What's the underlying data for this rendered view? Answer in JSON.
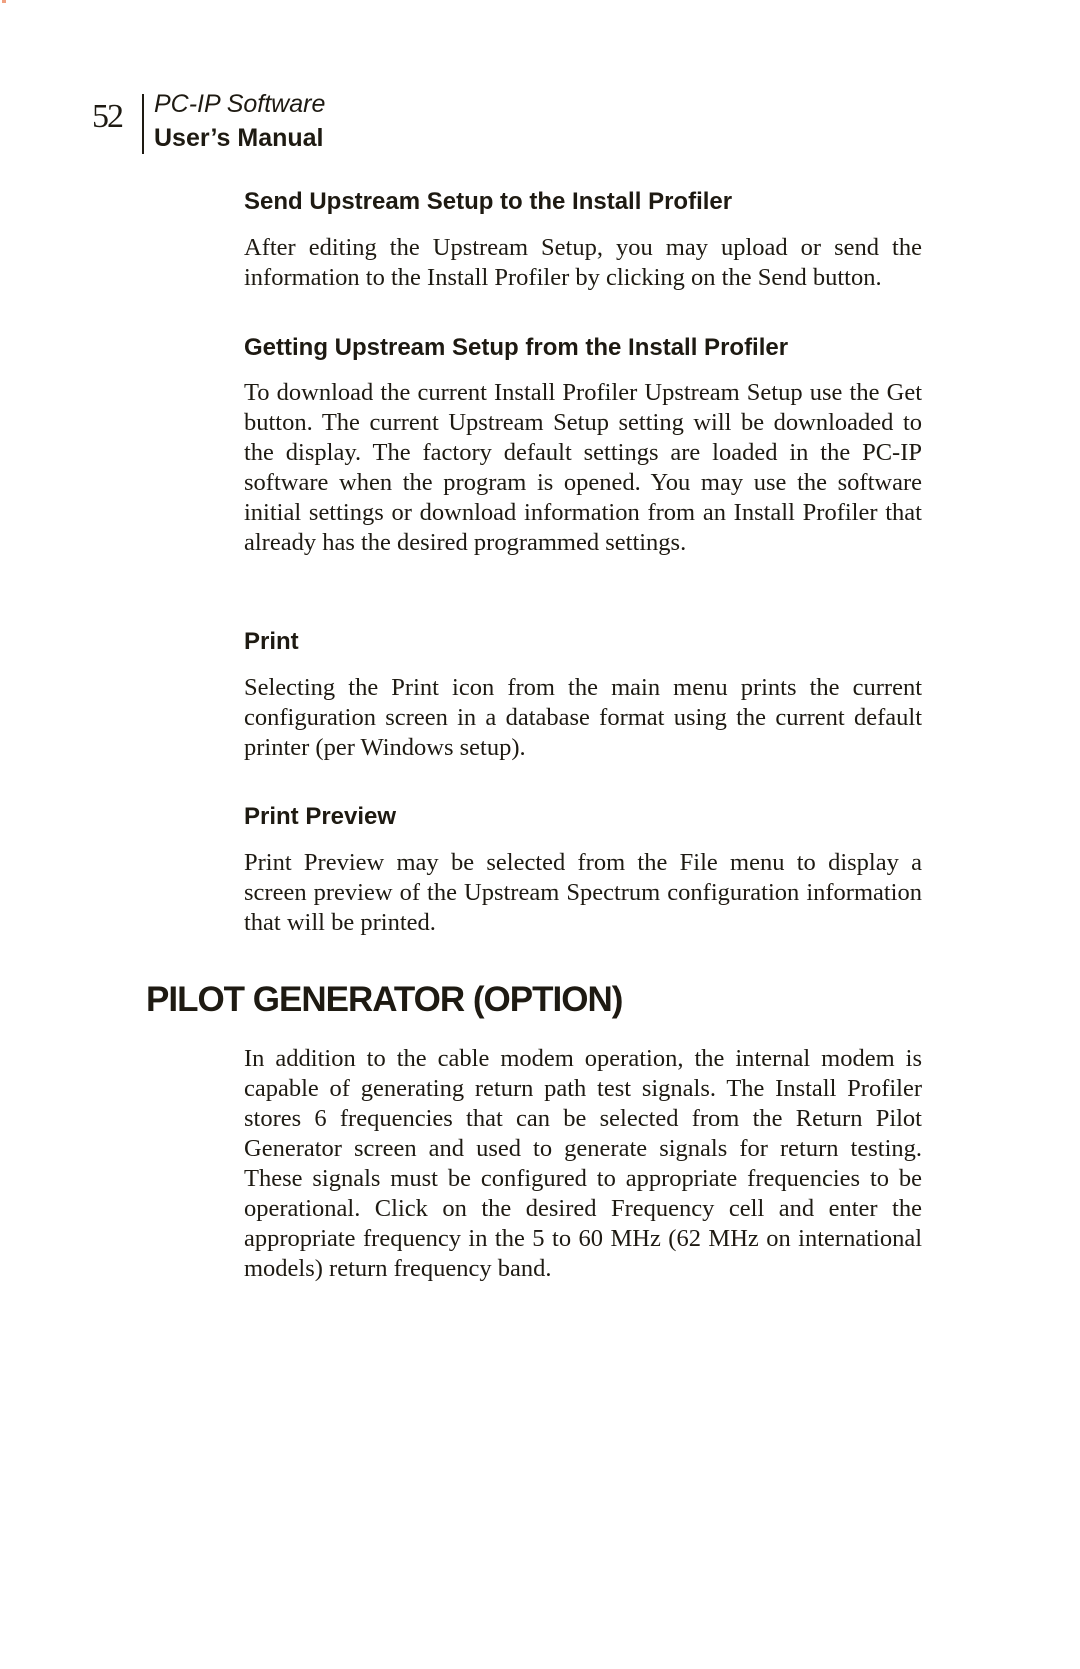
{
  "header": {
    "page_number": "52",
    "title": "PC-IP Software",
    "subtitle": "User’s Manual"
  },
  "sections": [
    {
      "heading": "Send Upstream Setup to the Install Profiler",
      "body": "After editing the Upstream Setup, you may upload or send the information to the Install Profiler by clicking on the Send button."
    },
    {
      "heading": "Getting Upstream Setup from the Install Profiler",
      "body": "To download the current Install Profiler Upstream Setup use the Get button. The current Upstream Setup setting will be downloaded to the display. The factory default settings are loaded in the PC-IP software when the program is opened. You may use the software initial settings or download information from an Install Profiler that already has the desired programmed settings."
    },
    {
      "heading": "Print",
      "body": "Selecting the Print icon from the main menu prints the current configuration screen in a database format using the current default printer (per Windows setup)."
    },
    {
      "heading": "Print Preview",
      "body": "Print Preview may be selected from the File menu to display a screen preview of the Upstream Spectrum configuration information that will be printed."
    }
  ],
  "chapter": {
    "heading": "PILOT GENERATOR (OPTION)",
    "body": "In addition to the cable modem operation, the internal modem is capable of generating return path test signals. The Install Profiler stores 6 frequencies that can be selected from the Return Pilot Generator screen and used to generate signals for return testing. These signals must be configured to appropriate frequencies to be operational. Click on the desired Frequency cell and enter the appropriate frequency in the 5 to 60 MHz (62 MHz on international models) return frequency band."
  }
}
